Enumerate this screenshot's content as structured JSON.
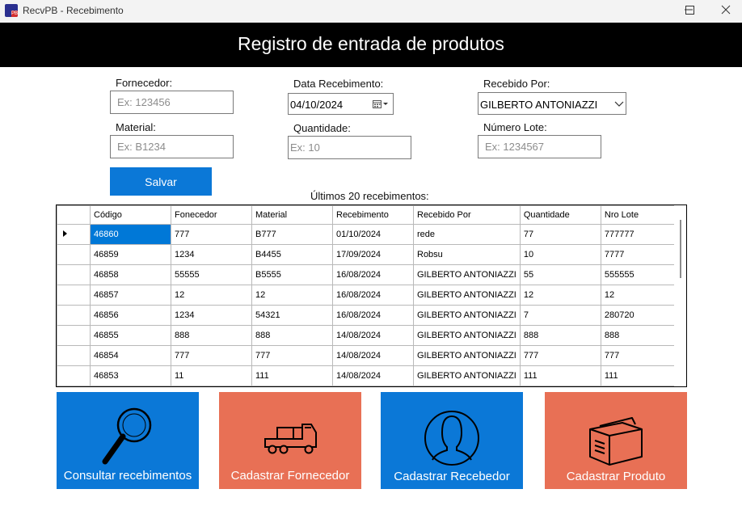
{
  "window": {
    "title": "RecvPB - Recebimento",
    "app_icon_text": "PB"
  },
  "header": {
    "title": "Registro de entrada de produtos"
  },
  "form": {
    "fornecedor": {
      "label": "Fornecedor:",
      "placeholder": "Ex: 123456"
    },
    "material": {
      "label": "Material:",
      "placeholder": "Ex: B1234"
    },
    "data_recebimento": {
      "label": "Data Recebimento:",
      "value": "04/10/2024"
    },
    "quantidade": {
      "label": "Quantidade:",
      "placeholder": "Ex: 10"
    },
    "recebido_por": {
      "label": "Recebido Por:",
      "value": "GILBERTO ANTONIAZZI"
    },
    "numero_lote": {
      "label": "Número Lote:",
      "placeholder": "Ex: 1234567"
    },
    "save_label": "Salvar"
  },
  "grid": {
    "caption": "Últimos 20 recebimentos:",
    "columns": [
      "Código",
      "Fonecedor",
      "Material",
      "Recebimento",
      "Recebido Por",
      "Quantidade",
      "Nro Lote"
    ],
    "rows": [
      [
        "46860",
        "777",
        "B777",
        "01/10/2024",
        "rede",
        "77",
        "777777"
      ],
      [
        "46859",
        "1234",
        "B4455",
        "17/09/2024",
        "Robsu",
        "10",
        "7777"
      ],
      [
        "46858",
        "55555",
        "B5555",
        "16/08/2024",
        "GILBERTO ANTONIAZZI",
        "55",
        "555555"
      ],
      [
        "46857",
        "12",
        "12",
        "16/08/2024",
        "GILBERTO ANTONIAZZI",
        "12",
        "12"
      ],
      [
        "46856",
        "1234",
        "54321",
        "16/08/2024",
        "GILBERTO ANTONIAZZI",
        "7",
        "280720"
      ],
      [
        "46855",
        "888",
        "888",
        "14/08/2024",
        "GILBERTO ANTONIAZZI",
        "888",
        "888"
      ],
      [
        "46854",
        "777",
        "777",
        "14/08/2024",
        "GILBERTO ANTONIAZZI",
        "777",
        "777"
      ],
      [
        "46853",
        "11",
        "111",
        "14/08/2024",
        "GILBERTO ANTONIAZZI",
        "111",
        "111"
      ]
    ],
    "selected_row": 0
  },
  "tiles": [
    {
      "label": "Consultar recebimentos",
      "icon": "search-icon",
      "color": "#0b78d7"
    },
    {
      "label": "Cadastrar Fornecedor",
      "icon": "truck-icon",
      "color": "#e87055"
    },
    {
      "label": "Cadastrar Recebedor",
      "icon": "user-icon",
      "color": "#0b78d7"
    },
    {
      "label": "Cadastrar Produto",
      "icon": "box-icon",
      "color": "#e87055"
    }
  ],
  "colors": {
    "accent_blue": "#0b78d7",
    "accent_orange": "#e87055",
    "header_bg": "#000000"
  }
}
